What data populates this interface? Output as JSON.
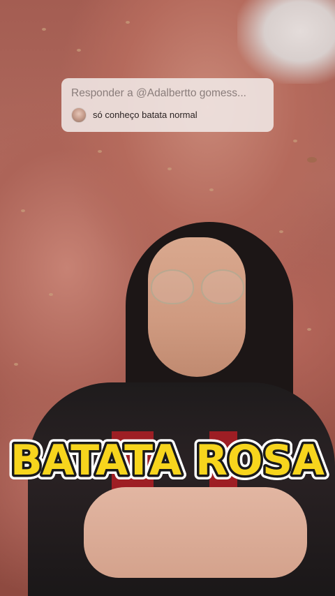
{
  "reply": {
    "header": "Responder a @Adalbertto gomess...",
    "comment": "só conheço batata normal"
  },
  "caption": {
    "text": "BATATA ROSA",
    "fill_color": "#f7d51d",
    "stroke_color": "#1a1a1a",
    "outline_color": "#ffffff"
  },
  "colors": {
    "card_background": "#f0e8e6",
    "header_text": "#8a7d7b",
    "comment_text": "#2a2222"
  },
  "icons": {
    "commenter_avatar": "avatar-icon"
  }
}
